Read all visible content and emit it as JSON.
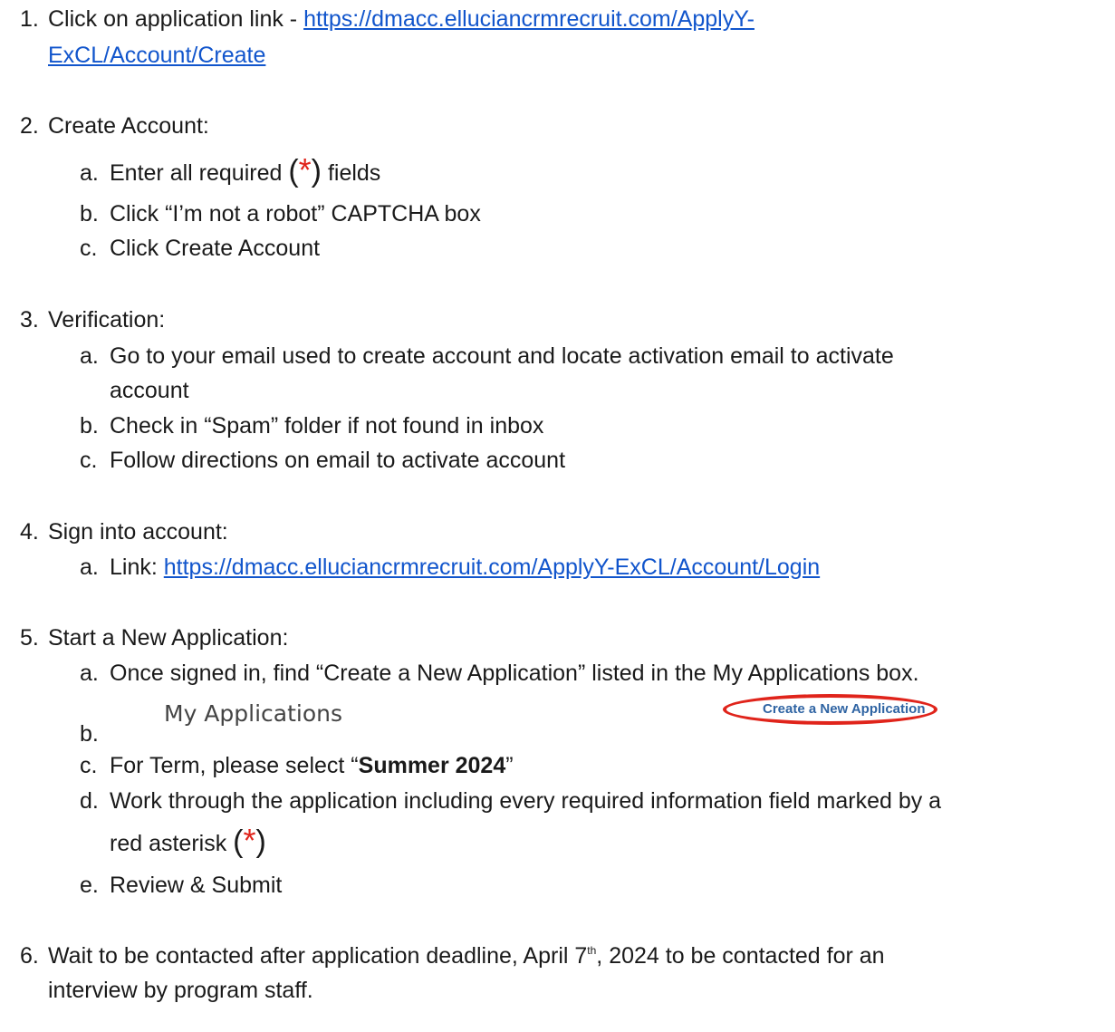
{
  "step1": {
    "number": "1.",
    "text": "Click on application link - ",
    "link_line1": "https://dmacc.elluciancrmrecruit.com/ApplyY-",
    "link_line2": "ExCL/Account/Create"
  },
  "step2": {
    "number": "2.",
    "title": "Create Account:",
    "a_letter": "a.",
    "a_text1": "Enter all required ",
    "a_paren_open": "(",
    "a_asterisk": "*",
    "a_paren_close": ")",
    "a_text2": " fields",
    "b_letter": "b.",
    "b_text": "Click “I’m not a robot” CAPTCHA box",
    "c_letter": "c.",
    "c_text": "Click Create Account"
  },
  "step3": {
    "number": "3.",
    "title": "Verification:",
    "a_letter": "a.",
    "a_text1": "Go to your email used to create account and locate activation email to activate",
    "a_text2": "account",
    "b_letter": "b.",
    "b_text": "Check in “Spam” folder if not found in inbox",
    "c_letter": "c.",
    "c_text": "Follow directions on email to activate account"
  },
  "step4": {
    "number": "4.",
    "title": "Sign into account:",
    "a_letter": "a.",
    "a_text": "Link: ",
    "a_link": "https://dmacc.elluciancrmrecruit.com/ApplyY-ExCL/Account/Login"
  },
  "step5": {
    "number": "5.",
    "title": "Start a New Application:",
    "a_letter": "a.",
    "a_text": "Once signed in, find “Create a New Application” listed in the My Applications box.",
    "b_letter": "b.",
    "screenshot": {
      "heading": "My Applications",
      "button_label": "Create a New Application",
      "highlight_color": "#e0241b"
    },
    "c_letter": "c.",
    "c_text1": "For Term, please select “",
    "c_bold": "Summer 2024",
    "c_text2": "”",
    "d_letter": "d.",
    "d_text1": "Work through the application including every required information field marked by a",
    "d_text2": "red asterisk ",
    "d_paren_open": "(",
    "d_asterisk": "*",
    "d_paren_close": ")",
    "e_letter": "e.",
    "e_text": "Review & Submit"
  },
  "step6": {
    "number": "6.",
    "text1": "Wait to be contacted after application deadline, April 7",
    "sup": "th",
    "text2": ", 2024 to be contacted for an",
    "text3": "interview by program staff."
  }
}
